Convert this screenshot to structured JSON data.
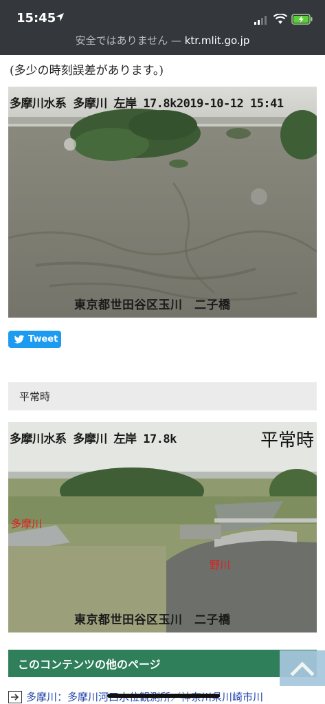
{
  "status_bar": {
    "time": "15:45"
  },
  "url_bar": {
    "security": "安全ではありません — ",
    "host": "ktr.mlit.go.jp"
  },
  "note": "(多少の時刻誤差があります。)",
  "live_camera": {
    "header": "多摩川水系 多摩川 左岸 17.8k2019-10-12 15:41",
    "footer": "東京都世田谷区玉川　二子橋"
  },
  "tweet_button": {
    "label": "Tweet"
  },
  "normal_section": {
    "heading": "平常時"
  },
  "normal_camera": {
    "header": "多摩川水系 多摩川 左岸 17.8k",
    "tag": "平常時",
    "label_tamagawa": "多摩川",
    "label_nogawa": "野川",
    "footer": "東京都世田谷区玉川　二子橋"
  },
  "other_pages": {
    "heading": "このコンテンツの他のページ",
    "first_link": "多摩川：多摩川河口水位観測所／神奈川県川崎市川"
  },
  "icons": [
    "location-arrow-icon",
    "signal-icon",
    "wifi-icon",
    "battery-icon",
    "twitter-bird-icon",
    "arrow-right-icon",
    "chevron-up-icon"
  ],
  "colors": {
    "topbar": "#34383c",
    "tweet": "#1d9bf0",
    "green_bar": "#2f7f5b",
    "link": "#2244aa",
    "river_label": "#e01c1c",
    "scroll_top": "#a7c7dd"
  }
}
